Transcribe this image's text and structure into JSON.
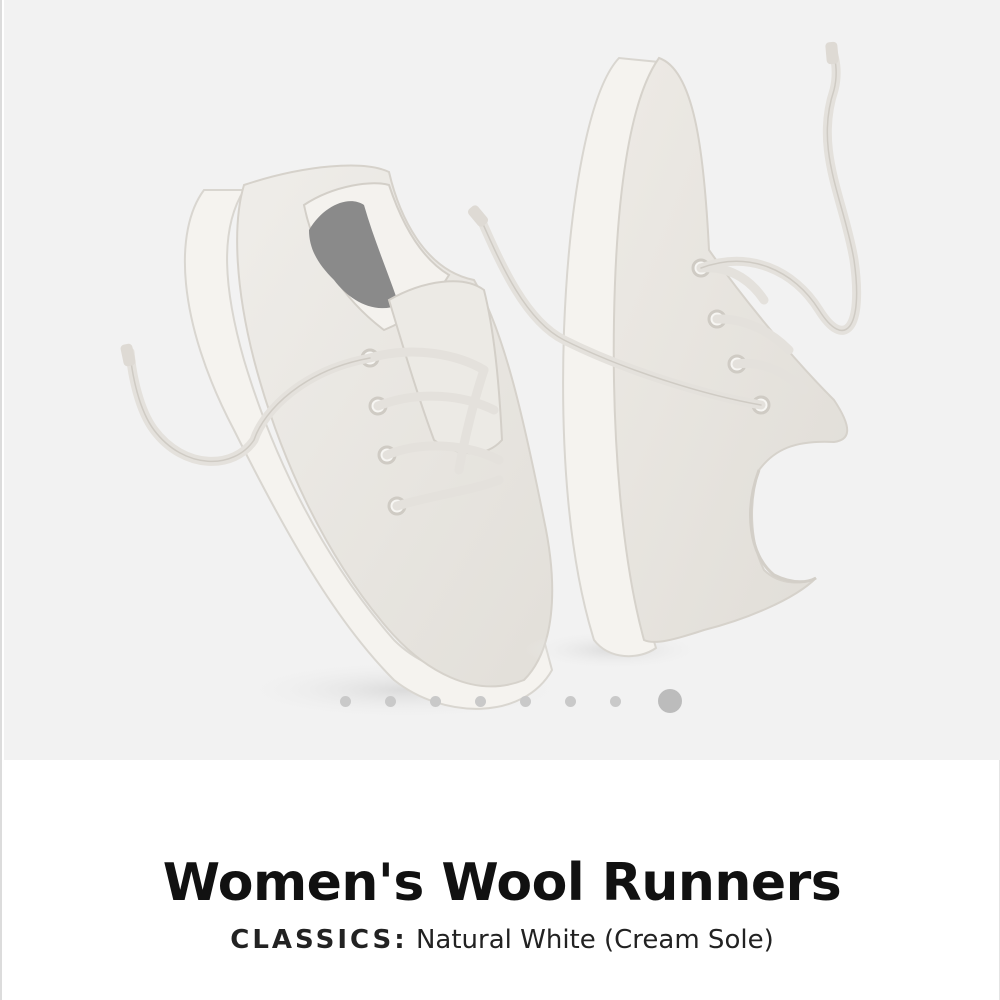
{
  "product": {
    "title": "Women's Wool Runners",
    "collection": "CLASSICS",
    "separator": ":",
    "color_name": "Natural White (Cream Sole)"
  },
  "carousel": {
    "slide_count": 8,
    "active_index": 7
  },
  "colors": {
    "background": "#f2f2f2",
    "shoe_upper": "#ebe8e3",
    "sole": "#f0eeea",
    "insole": "#8a8a8a",
    "dot": "#c9c9c9",
    "dot_active": "#bcbcbc"
  }
}
